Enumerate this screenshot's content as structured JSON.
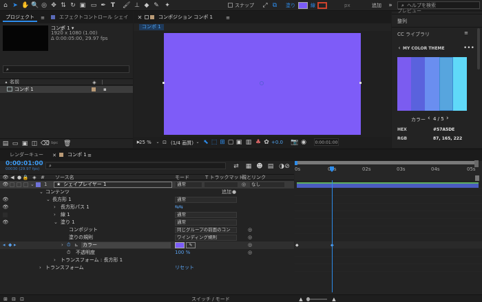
{
  "toolbar": {
    "snap_label": "スナップ",
    "fill_label": "塗り",
    "stroke_label": "線",
    "px_label": "px",
    "add_label": "追加",
    "help_placeholder": "ヘルプを検索",
    "fill_color": "#7b5cf7",
    "stroke_color": "#d0432c"
  },
  "project_panel": {
    "tab_project": "プロジェクト",
    "tab_effects": "エフェクトコントロール シェイプ",
    "comp_name": "コンポ 1 ▾",
    "comp_size": "1920 x 1080 (1.00)",
    "comp_duration": "Δ 0:00:05:00, 29.97 fps",
    "column_name": "名前",
    "item_name": "コンポ 1",
    "bpc": "8 bpc"
  },
  "composition_panel": {
    "tab_label": "コンポジション コンポ 1",
    "breadcrumb": "コンポ 1",
    "zoom": "25 %",
    "resolution": "(1/4 画質)",
    "exposure": "+0.0",
    "timecode": "0:00:01:00",
    "canvas_color": "#7e5cf8"
  },
  "right_panel": {
    "top_label": "プレビュー",
    "align_label": "整列",
    "libraries_label": "CC ライブラリ",
    "theme_title": "MY COLOR THEME",
    "color_label": "カラー",
    "page_indicator": "4 / 5",
    "hex_label": "HEX",
    "hex_value": "#57A5DE",
    "rgb_label": "RGB",
    "rgb_value": "87, 165, 222",
    "swatches": [
      "#7b5cf0",
      "#5a62dd",
      "#6a8ef0",
      "#57a5de",
      "#5fd9f8"
    ]
  },
  "timeline": {
    "tab_render": "レンダーキュー",
    "tab_comp": "コンポ 1",
    "timecode": "0:00:01:00",
    "frame_info": "00030 (29.97 fps)",
    "columns": {
      "source_name": "ソース名",
      "mode": "モード",
      "trackmatte": "T トラックマット",
      "parent": "親とリンク"
    },
    "ruler": [
      "0s",
      "01s",
      "02s",
      "03s",
      "04s",
      "05s"
    ],
    "layer": {
      "number": "1",
      "name": "シェイプレイヤー 1",
      "mode": "通常",
      "parent": "なし"
    },
    "rows": {
      "contents": "コンテンツ",
      "add": "追加",
      "rect1": "長方形 1",
      "rect1_mode": "通常",
      "rect_path": "長方形パス 1",
      "stroke1": "線 1",
      "stroke1_mode": "通常",
      "fill1": "塗り 1",
      "fill1_mode": "通常",
      "composite": "コンポジット",
      "composite_value": "同じグループの前面のコン",
      "fill_rule": "塗りの規則",
      "fill_rule_value": "ワインディング規則",
      "color": "カラー",
      "opacity": "不透明度",
      "opacity_value": "100 %",
      "transform_rect": "トランスフォーム : 長方形 1",
      "transform": "トランスフォーム",
      "reset": "リセット"
    },
    "footer_label": "スイッチ / モード"
  }
}
